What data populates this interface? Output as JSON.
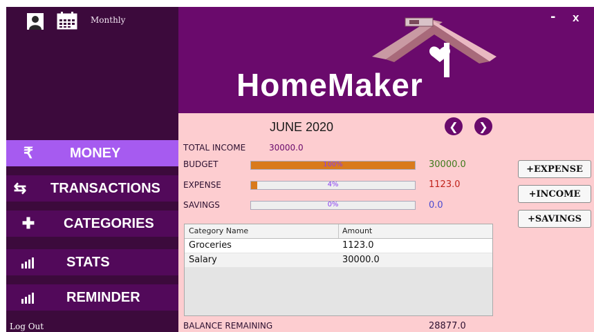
{
  "top": {
    "period_label": "Monthly"
  },
  "header": {
    "app_name": "HomeMaker",
    "minimize": "-",
    "close": "x"
  },
  "nav": {
    "money": "MONEY",
    "transactions": "TRANSACTIONS",
    "categories": "CATEGORIES",
    "stats": "STATS",
    "reminder": "REMINDER"
  },
  "logout": "Log Out",
  "period": {
    "title": "JUNE 2020"
  },
  "summary": {
    "income_label": "TOTAL INCOME",
    "income_value": "30000.0",
    "budget_label": "BUDGET",
    "budget_pct": "100%",
    "budget_value": "30000.0",
    "expense_label": "EXPENSE",
    "expense_pct": "4%",
    "expense_value": "1123.0",
    "savings_label": "SAVINGS",
    "savings_pct": "0%",
    "savings_value": "0.0",
    "balance_label": "BALANCE REMAINING",
    "balance_value": "28877.0"
  },
  "buttons": {
    "expense": "+EXPENSE",
    "income": "+INCOME",
    "savings": "+SAVINGS"
  },
  "table": {
    "headers": [
      "Category Name",
      "Amount"
    ],
    "rows": [
      [
        "Groceries",
        "1123.0"
      ],
      [
        "Salary",
        "30000.0"
      ]
    ]
  },
  "colors": {
    "sidebar": "#3c0a3c",
    "header": "#6a0a6c",
    "active_nav": "#a65bf0",
    "content_bg": "#fdcdd0",
    "bar_fill": "#d97a1c",
    "income_value": "#6a0a6c",
    "budget_value": "#3d7a1a",
    "expense_value": "#c0221a",
    "savings_value": "#4a4ad0"
  },
  "icons": [
    "user-icon",
    "calendar-icon",
    "rupee-icon",
    "transfer-icon",
    "plus-icon",
    "stats-icon",
    "reminder-icon",
    "chevron-left-icon",
    "chevron-right-icon",
    "house-logo"
  ]
}
